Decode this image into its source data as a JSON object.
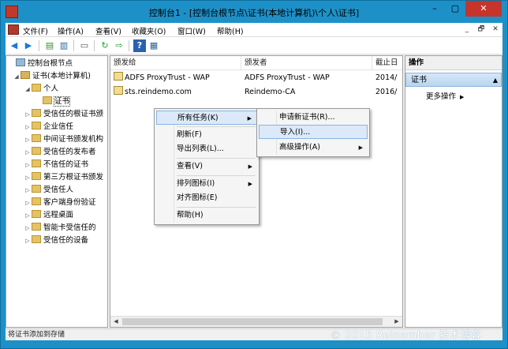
{
  "window": {
    "title": "控制台1 - [控制台根节点\\证书(本地计算机)\\个人\\证书]",
    "min": "–",
    "max": "▢",
    "close": "✕"
  },
  "menubar": {
    "items": [
      "文件(F)",
      "操作(A)",
      "查看(V)",
      "收藏夹(O)",
      "窗口(W)",
      "帮助(H)"
    ],
    "mdi": [
      "_",
      "🗗",
      "✕"
    ]
  },
  "toolbar": {
    "icons": [
      "back-arrow-icon",
      "forward-arrow-icon",
      "up-folder-icon",
      "show-hide-tree-icon",
      "clipboard-icon",
      "refresh-icon",
      "export-list-icon",
      "help-icon",
      "show-hide-action-pane-icon"
    ]
  },
  "tree": {
    "items": [
      {
        "label": "控制台根节点",
        "expander": "",
        "folder": "root"
      },
      {
        "label": "证书(本地计算机)",
        "expander": "◢",
        "folder": "cert"
      },
      {
        "label": "个人",
        "expander": "◢",
        "folder": "normal"
      },
      {
        "label": "证书",
        "expander": "",
        "folder": "normal"
      },
      {
        "label": "受信任的根证书颁",
        "expander": "▷",
        "folder": "normal"
      },
      {
        "label": "企业信任",
        "expander": "▷",
        "folder": "normal"
      },
      {
        "label": "中间证书颁发机构",
        "expander": "▷",
        "folder": "normal"
      },
      {
        "label": "受信任的发布者",
        "expander": "▷",
        "folder": "normal"
      },
      {
        "label": "不信任的证书",
        "expander": "▷",
        "folder": "normal"
      },
      {
        "label": "第三方根证书颁发",
        "expander": "▷",
        "folder": "normal"
      },
      {
        "label": "受信任人",
        "expander": "▷",
        "folder": "normal"
      },
      {
        "label": "客户端身份验证",
        "expander": "▷",
        "folder": "normal"
      },
      {
        "label": "远程桌面",
        "expander": "▷",
        "folder": "normal"
      },
      {
        "label": "智能卡受信任的",
        "expander": "▷",
        "folder": "normal"
      },
      {
        "label": "受信任的设备",
        "expander": "▷",
        "folder": "normal"
      }
    ]
  },
  "list": {
    "columns": [
      "颁发给",
      "颁发者",
      "截止日"
    ],
    "rows": [
      {
        "issued_to": "ADFS ProxyTrust - WAP",
        "issued_by": "ADFS ProxyTrust - WAP",
        "expires": "2014/"
      },
      {
        "issued_to": "sts.reindemo.com",
        "issued_by": "Reindemo-CA",
        "expires": "2016/"
      }
    ],
    "scroll_left": "◀",
    "scroll_right": "▶"
  },
  "actions": {
    "header": "操作",
    "section": "证书",
    "collapse": "▲",
    "more": "更多操作",
    "more_arrow": "▶"
  },
  "context_menu": {
    "items": [
      "所有任务(K)",
      "刷新(F)",
      "导出列表(L)...",
      "查看(V)",
      "排列图标(I)",
      "对齐图标(E)",
      "帮助(H)"
    ],
    "arrow": "▶"
  },
  "submenu": {
    "items": [
      "申请新证书(R)...",
      "导入(I)...",
      "高级操作(A)"
    ]
  },
  "statusbar": {
    "text": "将证书添加到存储"
  },
  "watermark": "© 2015 Reinember 技术博客"
}
